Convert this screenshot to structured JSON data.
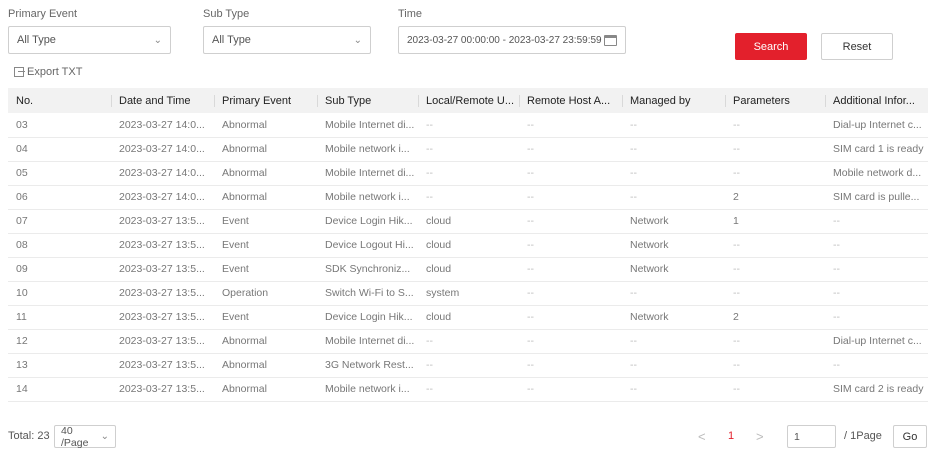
{
  "filters": {
    "primary_event": {
      "label": "Primary Event",
      "value": "All Type"
    },
    "sub_type": {
      "label": "Sub Type",
      "value": "All Type"
    },
    "time": {
      "label": "Time",
      "value": "2023-03-27 00:00:00  -  2023-03-27 23:59:59"
    },
    "search_label": "Search",
    "reset_label": "Reset"
  },
  "export_label": "Export TXT",
  "table": {
    "headers": [
      "No.",
      "Date and Time",
      "Primary Event",
      "Sub Type",
      "Local/Remote U...",
      "Remote Host A...",
      "Managed by",
      "Parameters",
      "Additional Infor..."
    ],
    "rows": [
      [
        "03",
        "2023-03-27 14:0...",
        "Abnormal",
        "Mobile Internet di...",
        "--",
        "--",
        "--",
        "--",
        "Dial-up Internet c..."
      ],
      [
        "04",
        "2023-03-27 14:0...",
        "Abnormal",
        "Mobile network i...",
        "--",
        "--",
        "--",
        "--",
        "SIM card 1 is ready"
      ],
      [
        "05",
        "2023-03-27 14:0...",
        "Abnormal",
        "Mobile Internet di...",
        "--",
        "--",
        "--",
        "--",
        "Mobile network d..."
      ],
      [
        "06",
        "2023-03-27 14:0...",
        "Abnormal",
        "Mobile network i...",
        "--",
        "--",
        "--",
        "2",
        "SIM card is pulle..."
      ],
      [
        "07",
        "2023-03-27 13:5...",
        "Event",
        "Device Login Hik...",
        "cloud",
        "--",
        "Network",
        "1",
        "--"
      ],
      [
        "08",
        "2023-03-27 13:5...",
        "Event",
        "Device Logout Hi...",
        "cloud",
        "--",
        "Network",
        "--",
        "--"
      ],
      [
        "09",
        "2023-03-27 13:5...",
        "Event",
        "SDK Synchroniz...",
        "cloud",
        "--",
        "Network",
        "--",
        "--"
      ],
      [
        "10",
        "2023-03-27 13:5...",
        "Operation",
        "Switch Wi-Fi to S...",
        "system",
        "--",
        "--",
        "--",
        "--"
      ],
      [
        "11",
        "2023-03-27 13:5...",
        "Event",
        "Device Login Hik...",
        "cloud",
        "--",
        "Network",
        "2",
        "--"
      ],
      [
        "12",
        "2023-03-27 13:5...",
        "Abnormal",
        "Mobile Internet di...",
        "--",
        "--",
        "--",
        "--",
        "Dial-up Internet c..."
      ],
      [
        "13",
        "2023-03-27 13:5...",
        "Abnormal",
        "3G Network Rest...",
        "--",
        "--",
        "--",
        "--",
        "--"
      ],
      [
        "14",
        "2023-03-27 13:5...",
        "Abnormal",
        "Mobile network i...",
        "--",
        "--",
        "--",
        "--",
        "SIM card 2 is ready"
      ]
    ]
  },
  "pagination": {
    "total": "Total: 23",
    "per_page": "40 /Page",
    "prev": "<",
    "current": "1",
    "next": ">",
    "page_input": "1",
    "page_total": "/ 1Page",
    "go_label": "Go"
  },
  "colors": {
    "accent": "#e3202c",
    "header_bg": "#f2f2f2"
  }
}
